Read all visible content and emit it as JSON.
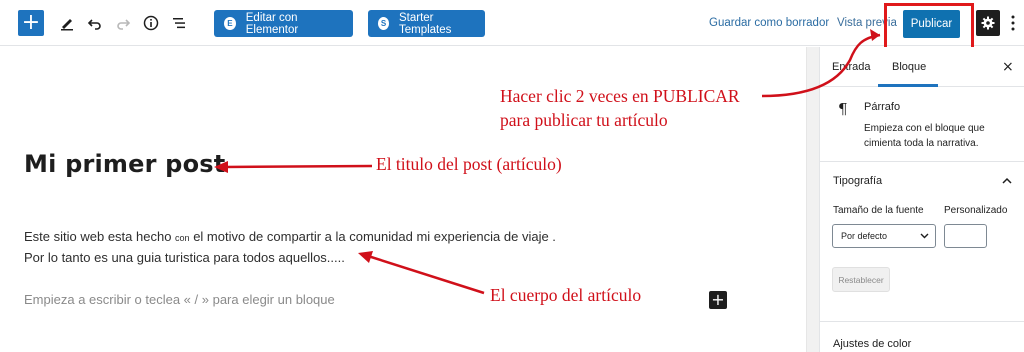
{
  "toolbar": {
    "add_icon": "plus-icon",
    "edit_label": "Editar con Elementor",
    "starter_label": "Starter Templates",
    "save_draft": "Guardar como borrador",
    "preview": "Vista previa",
    "publish": "Publicar",
    "elementor_badge": "E",
    "starter_badge": "S",
    "icons": [
      "pencil-icon",
      "undo-icon",
      "redo-icon",
      "info-icon",
      "list-view-icon",
      "gear-icon",
      "more-menu-icon"
    ]
  },
  "editor": {
    "title": "Mi primer post",
    "paragraph_line1_a": "Este sitio web esta hecho",
    "paragraph_line1_b": "con",
    "paragraph_line1_c": "el motivo de compartir a la comunidad mi experiencia de viaje .",
    "paragraph_line2": "Por lo tanto es una guia turistica para todos aquellos.....",
    "placeholder": "Empieza a escribir o teclea « / » para elegir un bloque",
    "inserter": "+"
  },
  "sidebar": {
    "tabs": [
      {
        "label": "Entrada"
      },
      {
        "label": "Bloque"
      }
    ],
    "active_tab": "Bloque",
    "close": "×",
    "block_icon": "¶",
    "block_name": "Párrafo",
    "block_description": "Empieza con el bloque que cimienta toda la narrativa.",
    "typography": {
      "title": "Tipografía",
      "font_size_label": "Tamaño de la fuente",
      "custom_label": "Personalizado",
      "select_value": "Por defecto",
      "reset": "Restablecer"
    },
    "color_settings": "Ajustes de color"
  },
  "annotations": {
    "publish_note_line1": "Hacer clic 2 veces en PUBLICAR",
    "publish_note_line2": "para publicar tu artículo",
    "title_note": "El titulo del post (artículo)",
    "body_note": "El cuerpo del artículo"
  },
  "colors": {
    "accent": "#1e73be",
    "annotation": "#d0101a",
    "text": "#1e1e1e"
  }
}
